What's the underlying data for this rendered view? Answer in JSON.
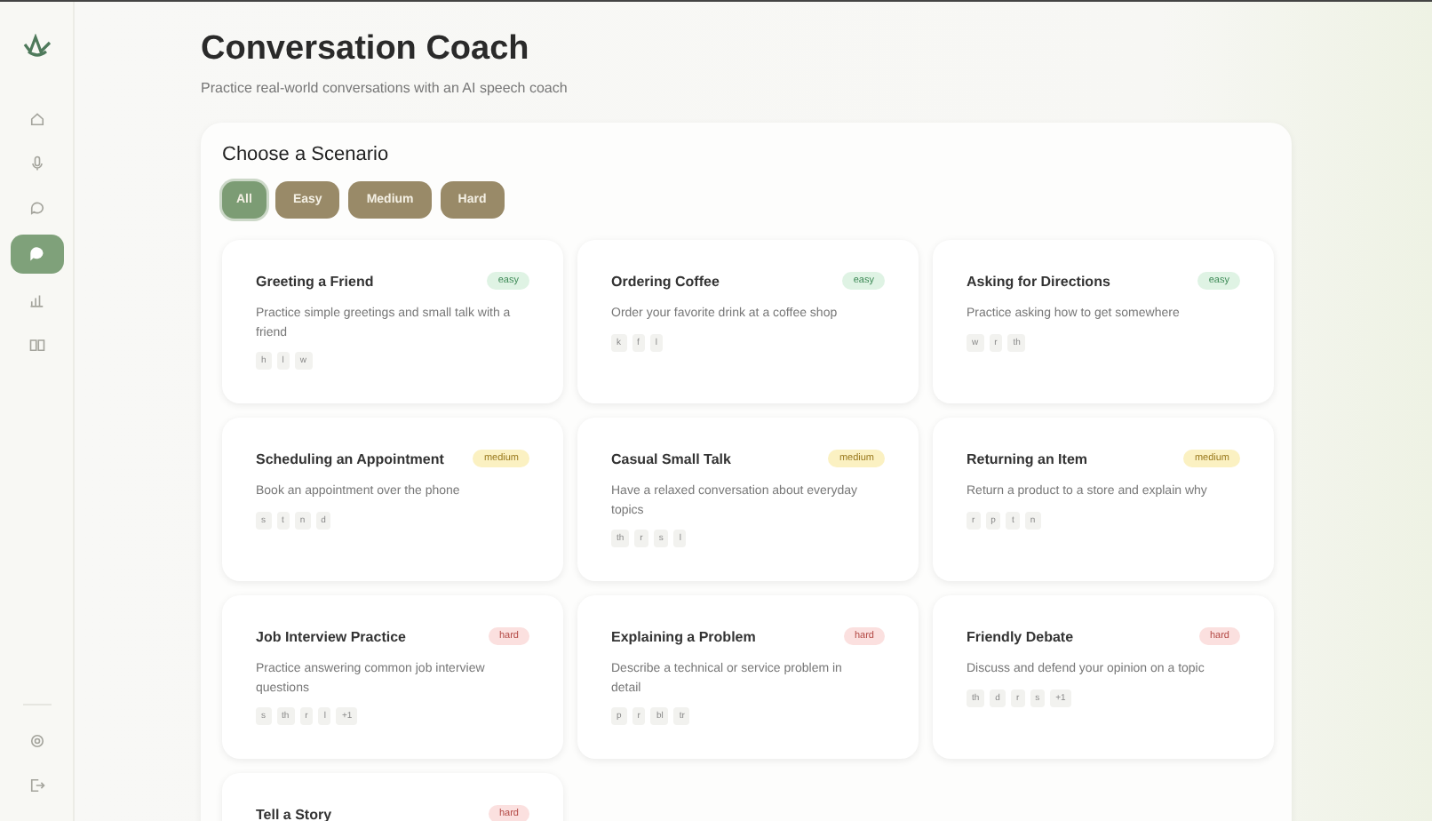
{
  "sidebar": {
    "nav_items": [
      {
        "selected": false
      },
      {
        "selected": false
      },
      {
        "selected": false
      },
      {
        "selected": true
      },
      {
        "selected": false
      },
      {
        "selected": false
      }
    ],
    "bottom_items": [
      {
        "selected": false
      },
      {
        "selected": false
      }
    ]
  },
  "header": {
    "title": "Conversation Coach",
    "subtitle": "Practice real-world conversations with an AI speech coach"
  },
  "panel": {
    "title": "Choose a Scenario",
    "filters": [
      {
        "label": "All",
        "selected": true
      },
      {
        "label": "Easy",
        "selected": false
      },
      {
        "label": "Medium",
        "selected": false
      },
      {
        "label": "Hard",
        "selected": false
      }
    ],
    "scenarios": [
      {
        "title": "Greeting a Friend",
        "difficulty": "easy",
        "kind": "easy",
        "description": "Practice simple greetings and small talk with a friend",
        "sounds": [
          "h",
          "l",
          "w"
        ]
      },
      {
        "title": "Ordering Coffee",
        "difficulty": "easy",
        "kind": "easy",
        "description": "Order your favorite drink at a coffee shop",
        "sounds": [
          "k",
          "f",
          "l"
        ]
      },
      {
        "title": "Asking for Directions",
        "difficulty": "easy",
        "kind": "easy",
        "description": "Practice asking how to get somewhere",
        "sounds": [
          "w",
          "r",
          "th"
        ]
      },
      {
        "title": "Scheduling an Appointment",
        "difficulty": "medium",
        "kind": "medium",
        "description": "Book an appointment over the phone",
        "sounds": [
          "s",
          "t",
          "n",
          "d"
        ]
      },
      {
        "title": "Casual Small Talk",
        "difficulty": "medium",
        "kind": "medium",
        "description": "Have a relaxed conversation about everyday topics",
        "sounds": [
          "th",
          "r",
          "s",
          "l"
        ]
      },
      {
        "title": "Returning an Item",
        "difficulty": "medium",
        "kind": "medium",
        "description": "Return a product to a store and explain why",
        "sounds": [
          "r",
          "p",
          "t",
          "n"
        ]
      },
      {
        "title": "Job Interview Practice",
        "difficulty": "hard",
        "kind": "hard",
        "description": "Practice answering common job interview questions",
        "sounds": [
          "s",
          "th",
          "r",
          "l",
          "+1"
        ]
      },
      {
        "title": "Explaining a Problem",
        "difficulty": "hard",
        "kind": "hard",
        "description": "Describe a technical or service problem in detail",
        "sounds": [
          "p",
          "r",
          "bl",
          "tr"
        ]
      },
      {
        "title": "Friendly Debate",
        "difficulty": "hard",
        "kind": "hard",
        "description": "Discuss and defend your opinion on a topic",
        "sounds": [
          "th",
          "d",
          "r",
          "s",
          "+1"
        ]
      },
      {
        "title": "Tell a Story",
        "difficulty": "hard",
        "kind": "hard"
      }
    ]
  }
}
